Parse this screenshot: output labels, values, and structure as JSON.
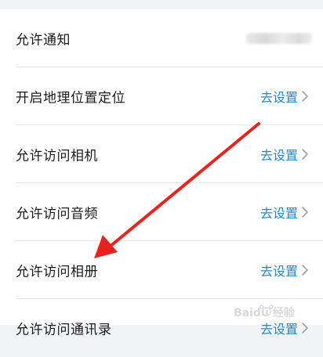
{
  "settings": {
    "rows": [
      {
        "label": "允许通知",
        "action": ""
      },
      {
        "label": "开启地理位置定位",
        "action": "去设置"
      },
      {
        "label": "允许访问相机",
        "action": "去设置"
      },
      {
        "label": "允许访问音频",
        "action": "去设置"
      },
      {
        "label": "允许访问相册",
        "action": "去设置"
      },
      {
        "label": "允许访问通讯录",
        "action": "去设置"
      }
    ]
  },
  "watermark": {
    "text": "Baidu 经验"
  },
  "colors": {
    "accent": "#1e88d6",
    "arrow": "#e8231d",
    "chevron": "#a0a0a0"
  },
  "icons": {
    "chevron": "chevron-right-icon",
    "arrow": "red-annotation-arrow"
  }
}
